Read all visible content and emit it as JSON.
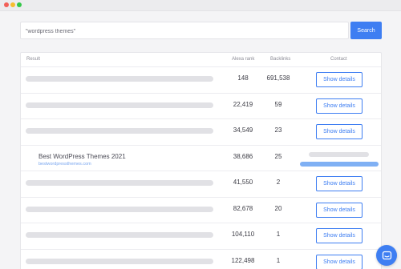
{
  "search": {
    "value": "\"wordpress themes\"",
    "button_label": "Search"
  },
  "table": {
    "headers": {
      "result": "Result",
      "alexa": "Alexa rank",
      "backlinks": "Backlinks",
      "contact": "Contact"
    },
    "rows": [
      {
        "alexa": "148",
        "backlinks": "691,538",
        "action": "Show details"
      },
      {
        "alexa": "22,419",
        "backlinks": "59",
        "action": "Show details"
      },
      {
        "alexa": "34,549",
        "backlinks": "23",
        "action": "Show details"
      },
      {
        "title": "Best WordPress Themes 2021",
        "url": "bestwordpressthemes.com",
        "alexa": "38,686",
        "backlinks": "25"
      },
      {
        "alexa": "41,550",
        "backlinks": "2",
        "action": "Show details"
      },
      {
        "alexa": "82,678",
        "backlinks": "20",
        "action": "Show details"
      },
      {
        "alexa": "104,110",
        "backlinks": "1",
        "action": "Show details"
      },
      {
        "alexa": "122,498",
        "backlinks": "1",
        "action": "Show details"
      }
    ]
  },
  "colors": {
    "accent": "#3e7ef2",
    "placeholder_bar": "#e1e1e5",
    "url_text": "#79a6ef"
  },
  "icons": {
    "chat": "chat-bubble-icon"
  }
}
